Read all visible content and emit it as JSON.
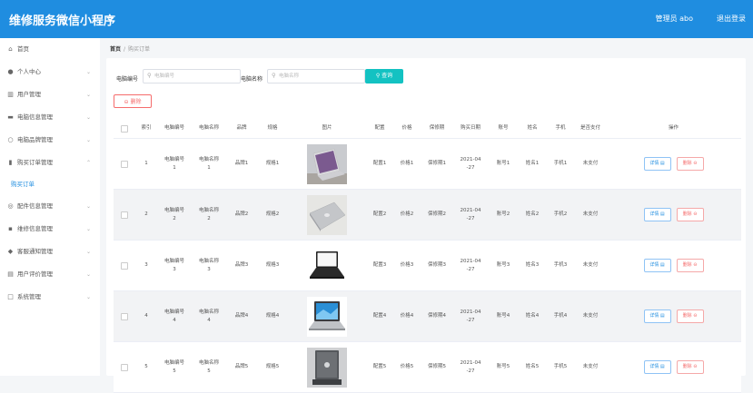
{
  "header": {
    "title": "维修服务微信小程序",
    "admin_label": "管理员 abo",
    "logout_label": "退出登录"
  },
  "sidebar": {
    "items": [
      {
        "label": "首页",
        "icon": "home-icon",
        "glyph": "⌂"
      },
      {
        "label": "个人中心",
        "icon": "user-icon",
        "glyph": "●"
      },
      {
        "label": "用户管理",
        "icon": "chart-icon",
        "glyph": "▥"
      },
      {
        "label": "电脑信息管理",
        "icon": "card-icon",
        "glyph": "▬"
      },
      {
        "label": "电脑品牌管理",
        "icon": "bulb-icon",
        "glyph": "○"
      },
      {
        "label": "购买订单管理",
        "icon": "bar-chart-icon",
        "glyph": "▮"
      },
      {
        "label": "配件信息管理",
        "icon": "globe-icon",
        "glyph": "◎"
      },
      {
        "label": "维修信息管理",
        "icon": "message-icon",
        "glyph": "▪"
      },
      {
        "label": "客服通知管理",
        "icon": "bell-icon",
        "glyph": "◆"
      },
      {
        "label": "用户评价管理",
        "icon": "bank-icon",
        "glyph": "▤"
      },
      {
        "label": "系统管理",
        "icon": "chat-icon",
        "glyph": "□"
      }
    ],
    "sub_item": "购买订单",
    "chevron": "⌄",
    "chevron_up": "⌃"
  },
  "breadcrumb": {
    "home": "首页",
    "separator": "/",
    "current": "购买订单"
  },
  "search": {
    "label1": "电脑编号",
    "placeholder1": "电脑编号",
    "label2": "电脑名称",
    "placeholder2": "电脑名称",
    "button": "查询",
    "search_glyph": "⚲"
  },
  "toolbar": {
    "delete_label": "删除",
    "delete_glyph": "⊖"
  },
  "table": {
    "headers": [
      "",
      "索引",
      "电脑编号",
      "电脑名称",
      "品牌",
      "规格",
      "图片",
      "配置",
      "价格",
      "保修期",
      "购买日期",
      "账号",
      "姓名",
      "手机",
      "是否支付",
      "操作"
    ],
    "edit_label": "详情",
    "delete_label": "删除",
    "rows": [
      {
        "index": "1",
        "code": "电脑编号 1",
        "name": "电脑名称 1",
        "brand": "品牌1",
        "spec": "规格1",
        "image": "laptop-purple",
        "config": "配置1",
        "price": "价格1",
        "warranty": "保修期1",
        "date": "2021-04 -27",
        "account": "账号1",
        "person": "姓名1",
        "phone": "手机1",
        "paid": "未支付"
      },
      {
        "index": "2",
        "code": "电脑编号 2",
        "name": "电脑名称 2",
        "brand": "品牌2",
        "spec": "规格2",
        "image": "laptop-silver",
        "config": "配置2",
        "price": "价格2",
        "warranty": "保修期2",
        "date": "2021-04 -27",
        "account": "账号2",
        "person": "姓名2",
        "phone": "手机2",
        "paid": "未支付"
      },
      {
        "index": "3",
        "code": "电脑编号 3",
        "name": "电脑名称 3",
        "brand": "品牌3",
        "spec": "规格3",
        "image": "laptop-black",
        "config": "配置3",
        "price": "价格3",
        "warranty": "保修期3",
        "date": "2021-04 -27",
        "account": "账号3",
        "person": "姓名3",
        "phone": "手机3",
        "paid": "未支付"
      },
      {
        "index": "4",
        "code": "电脑编号 4",
        "name": "电脑名称 4",
        "brand": "品牌4",
        "spec": "规格4",
        "image": "laptop-blue-screen",
        "config": "配置4",
        "price": "价格4",
        "warranty": "保修期4",
        "date": "2021-04 -27",
        "account": "账号4",
        "person": "姓名4",
        "phone": "手机4",
        "paid": "未支付"
      },
      {
        "index": "5",
        "code": "电脑编号 5",
        "name": "电脑名称 5",
        "brand": "品牌5",
        "spec": "规格5",
        "image": "laptop-gray",
        "config": "配置5",
        "price": "价格5",
        "warranty": "保修期5",
        "date": "2021-04 -27",
        "account": "账号5",
        "person": "姓名5",
        "phone": "手机5",
        "paid": "未支付"
      }
    ]
  },
  "colors": {
    "header": "#1f8de0",
    "search_button": "#13c2c2",
    "danger": "#f56c6c",
    "row_alt": "#f2f3f5"
  }
}
